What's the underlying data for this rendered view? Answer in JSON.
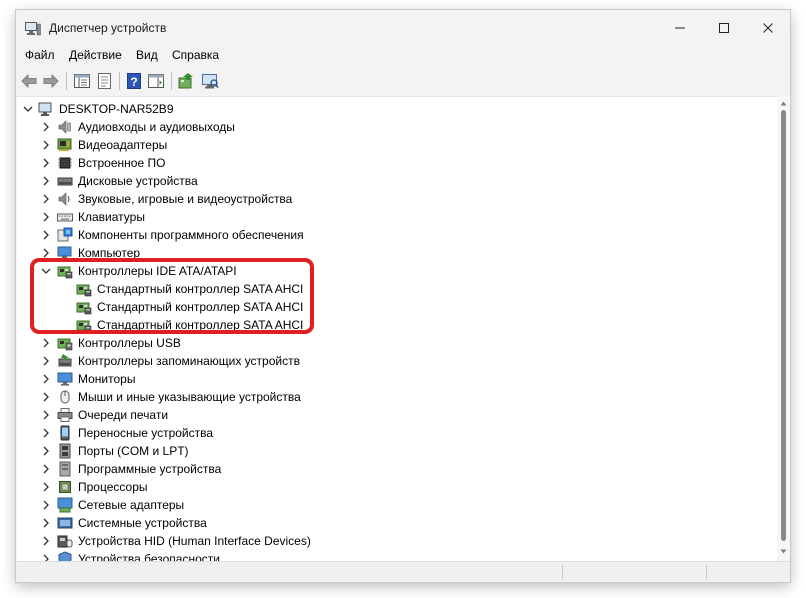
{
  "window": {
    "title": "Диспетчер устройств"
  },
  "menu": [
    {
      "label": "Файл"
    },
    {
      "label": "Действие"
    },
    {
      "label": "Вид"
    },
    {
      "label": "Справка"
    }
  ],
  "tree": {
    "root": "DESKTOP-NAR52B9",
    "rows": [
      {
        "label": "Аудиовходы и аудиовыходы",
        "icon": "speaker-icon",
        "state": "collapsed"
      },
      {
        "label": "Видеоадаптеры",
        "icon": "display-adapter-icon",
        "state": "collapsed"
      },
      {
        "label": "Встроенное ПО",
        "icon": "firmware-icon",
        "state": "collapsed"
      },
      {
        "label": "Дисковые устройства",
        "icon": "disk-drive-icon",
        "state": "collapsed"
      },
      {
        "label": "Звуковые, игровые и видеоустройства",
        "icon": "sound-icon",
        "state": "collapsed"
      },
      {
        "label": "Клавиатуры",
        "icon": "keyboard-icon",
        "state": "collapsed"
      },
      {
        "label": "Компоненты программного обеспечения",
        "icon": "software-component-icon",
        "state": "collapsed"
      },
      {
        "label": "Компьютер",
        "icon": "computer-icon",
        "state": "collapsed"
      },
      {
        "label": "Контроллеры IDE ATA/ATAPI",
        "icon": "ide-controller-icon",
        "state": "expanded",
        "children": [
          {
            "label": "Стандартный контроллер SATA AHCI",
            "icon": "ide-controller-icon"
          },
          {
            "label": "Стандартный контроллер SATA AHCI",
            "icon": "ide-controller-icon"
          },
          {
            "label": "Стандартный контроллер SATA AHCI",
            "icon": "ide-controller-icon"
          }
        ]
      },
      {
        "label": "Контроллеры USB",
        "icon": "usb-icon",
        "state": "collapsed"
      },
      {
        "label": "Контроллеры запоминающих устройств",
        "icon": "storage-controller-icon",
        "state": "collapsed"
      },
      {
        "label": "Мониторы",
        "icon": "monitor-icon",
        "state": "collapsed"
      },
      {
        "label": "Мыши и иные указывающие устройства",
        "icon": "mouse-icon",
        "state": "collapsed"
      },
      {
        "label": "Очереди печати",
        "icon": "printer-icon",
        "state": "collapsed"
      },
      {
        "label": "Переносные устройства",
        "icon": "portable-device-icon",
        "state": "collapsed"
      },
      {
        "label": "Порты (COM и LPT)",
        "icon": "port-icon",
        "state": "collapsed"
      },
      {
        "label": "Программные устройства",
        "icon": "software-device-icon",
        "state": "collapsed"
      },
      {
        "label": "Процессоры",
        "icon": "processor-icon",
        "state": "collapsed"
      },
      {
        "label": "Сетевые адаптеры",
        "icon": "network-adapter-icon",
        "state": "collapsed"
      },
      {
        "label": "Системные устройства",
        "icon": "system-device-icon",
        "state": "collapsed"
      },
      {
        "label": "Устройства HID (Human Interface Devices)",
        "icon": "hid-icon",
        "state": "collapsed"
      },
      {
        "label": "Устройства безопасности",
        "icon": "security-device-icon",
        "state": "collapsed"
      }
    ]
  },
  "colors": {
    "highlight": "#e02020",
    "accent": "#0a64c8"
  }
}
